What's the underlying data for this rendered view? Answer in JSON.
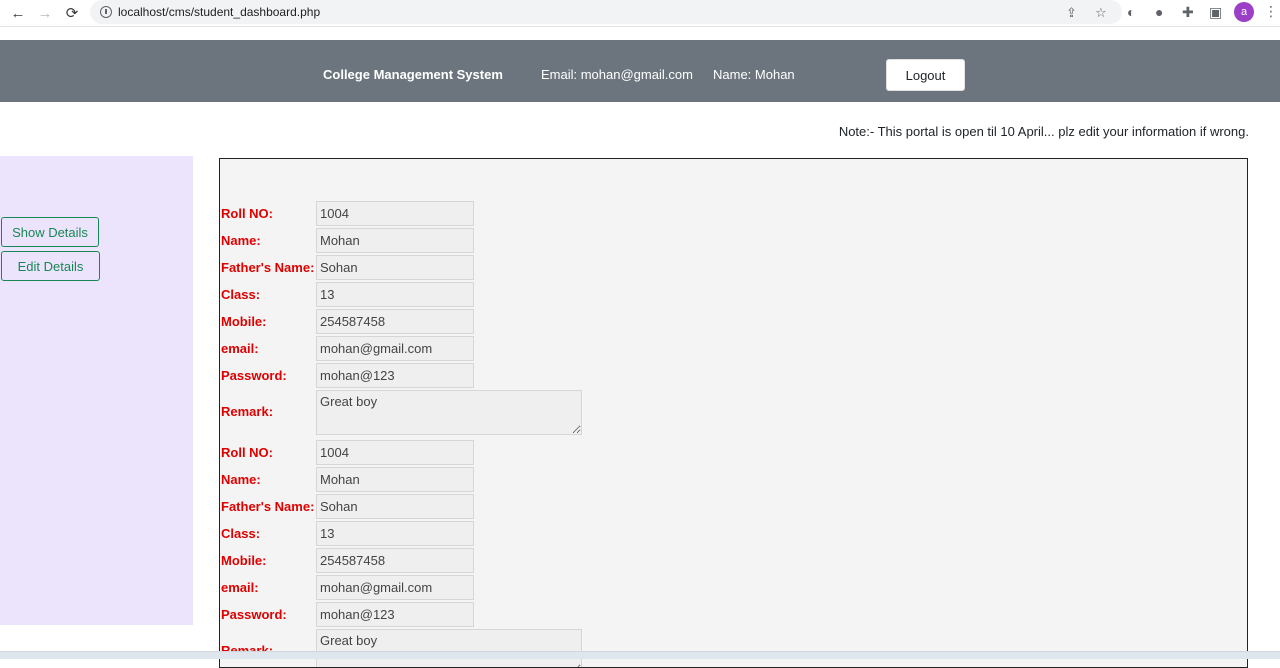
{
  "browser": {
    "back": "←",
    "forward": "→",
    "reload": "⟳",
    "url": "localhost/cms/student_dashboard.php",
    "avatar_letter": "a"
  },
  "header": {
    "title": "College Management System",
    "email": "Email: mohan@gmail.com",
    "name": "Name: Mohan",
    "logout": "Logout"
  },
  "note": "Note:- This portal is open til 10 April... plz edit your information if wrong.",
  "sidebar": {
    "show_details": "Show Details",
    "edit_details": "Edit Details"
  },
  "records": [
    {
      "roll_label": "Roll NO:",
      "roll": "1004",
      "name_label": "Name:",
      "name": "Mohan",
      "father_label": "Father's Name:",
      "father": "Sohan",
      "class_label": "Class:",
      "class": "13",
      "mobile_label": "Mobile:",
      "mobile": "254587458",
      "email_label": "email:",
      "email": "mohan@gmail.com",
      "password_label": "Password:",
      "password": "mohan@123",
      "remark_label": "Remark:",
      "remark": "Great boy"
    },
    {
      "roll_label": "Roll NO:",
      "roll": "1004",
      "name_label": "Name:",
      "name": "Mohan",
      "father_label": "Father's Name:",
      "father": "Sohan",
      "class_label": "Class:",
      "class": "13",
      "mobile_label": "Mobile:",
      "mobile": "254587458",
      "email_label": "email:",
      "email": "mohan@gmail.com",
      "password_label": "Password:",
      "password": "mohan@123",
      "remark_label": "Remark:",
      "remark": "Great boy"
    }
  ],
  "colors": {
    "header_bg": "#6c757d",
    "sidebar_bg": "#ece3fc",
    "label_red": "#e00000",
    "button_green": "#198754"
  }
}
